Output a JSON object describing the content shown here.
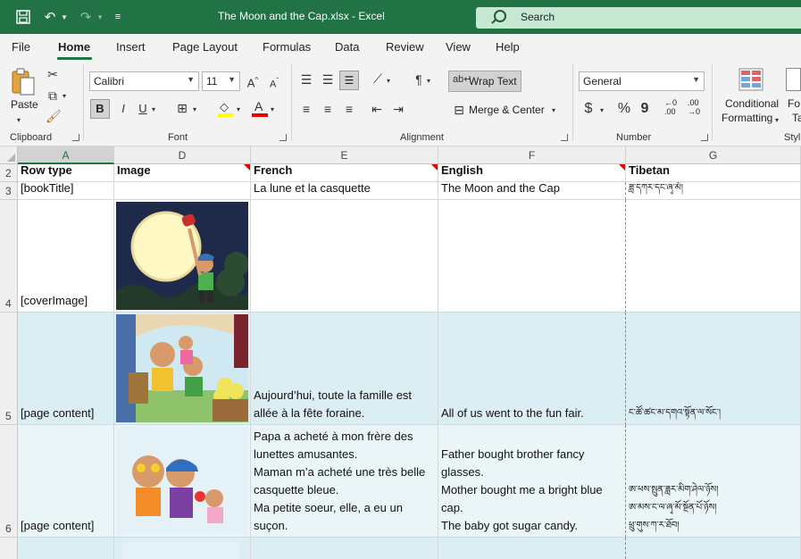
{
  "title_bar": {
    "window_title": "The Moon and the Cap.xlsx  -  Excel",
    "search_placeholder": "Search"
  },
  "menu": {
    "tabs": [
      "File",
      "Home",
      "Insert",
      "Page Layout",
      "Formulas",
      "Data",
      "Review",
      "View",
      "Help"
    ],
    "active_tab": "Home"
  },
  "ribbon": {
    "clipboard": {
      "paste_label": "Paste",
      "group_label": "Clipboard"
    },
    "font": {
      "font_name": "Calibri",
      "font_size": "11",
      "bold": "B",
      "italic": "I",
      "underline": "U",
      "group_label": "Font"
    },
    "alignment": {
      "wrap_text": "Wrap Text",
      "merge_center": "Merge & Center",
      "group_label": "Alignment"
    },
    "number": {
      "format": "General",
      "currency": "$",
      "percent": "%",
      "comma": "9",
      "inc_decimal": ".00",
      "dec_decimal": ".00",
      "group_label": "Number"
    },
    "styles": {
      "conditional_line1": "Conditional",
      "conditional_line2": "Formatting",
      "format_partial_1": "Fo",
      "format_partial_2": "Ta",
      "group_label": "Styl"
    }
  },
  "grid": {
    "columns": [
      "A",
      "D",
      "E",
      "F",
      "G"
    ],
    "selected_column": "A",
    "rows": [
      {
        "num": "2",
        "cells": [
          "Row type",
          "Image",
          "French",
          "English",
          "Tibetan"
        ]
      },
      {
        "num": "3",
        "cells": [
          "[bookTitle]",
          "",
          "La lune et la casquette",
          "The Moon and the Cap",
          "ཟླ་དཀར་དང་ཞྭ་མོ།"
        ]
      },
      {
        "num": "4",
        "cells": [
          "[coverImage]",
          "",
          "",
          "",
          ""
        ]
      },
      {
        "num": "5",
        "cells": [
          "[page content]",
          "",
          "Aujourd’hui, toute la famille est allée à la fête foraine.",
          "All of us went to the fun fair.",
          "ང་ཚོ་ཚང་མ་དགའ་སྟོན་ལ་སོང་།"
        ]
      },
      {
        "num": "6",
        "cells": [
          "[page content]",
          "",
          "Papa a acheté à mon frère des lunettes amusantes.\nMaman m’a acheté une très belle casquette bleue.\nMa petite soeur, elle, a eu un suçon.",
          "Father bought brother fancy glasses.\nMother bought me a bright blue cap.\nThe baby got sugar candy.",
          "ཨ་ཕས་སྤུན་ཟླར་མིག་ཤེལ་ཉོས།\nཨ་མས་ང་ལ་ཞྭ་མོ་སྔོན་པོ་ཉོས།\nཕྲུ་གུས་ཀ་ར་ཐོབ།"
        ]
      }
    ]
  }
}
